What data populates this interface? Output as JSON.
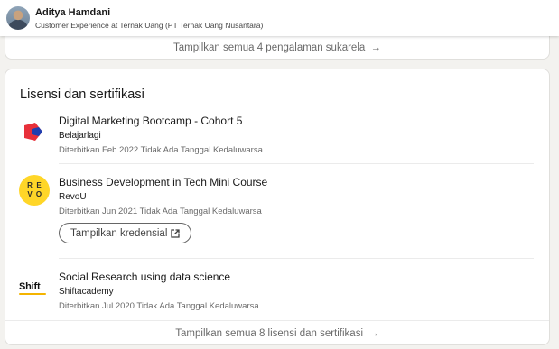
{
  "header": {
    "name": "Aditya Hamdani",
    "headline": "Customer Experience at Ternak Uang (PT Ternak Uang Nusantara)"
  },
  "volunteer": {
    "show_all_label": "Tampilkan semua 4 pengalaman sukarela",
    "arrow": "→"
  },
  "certifications": {
    "title": "Lisensi dan sertifikasi",
    "items": [
      {
        "title": "Digital Marketing Bootcamp - Cohort 5",
        "org": "Belajarlagi",
        "date": "Diterbitkan Feb 2022 Tidak Ada Tanggal Kedaluwarsa",
        "logo": "belajarlagi-logo"
      },
      {
        "title": "Business Development in Tech Mini Course",
        "org": "RevoU",
        "date": "Diterbitkan Jun 2021 Tidak Ada Tanggal Kedaluwarsa",
        "logo": "revou-logo",
        "logo_letters": [
          "R",
          "E",
          "V",
          "O"
        ],
        "button": "Tampilkan kredensial"
      },
      {
        "title": "Social Research using data science",
        "org": "Shiftacademy",
        "date": "Diterbitkan Jul 2020 Tidak Ada Tanggal Kedaluwarsa",
        "logo": "shiftacademy-logo",
        "logo_text": "Shift"
      }
    ],
    "show_all_label": "Tampilkan semua 8 lisensi dan sertifikasi",
    "arrow": "→"
  },
  "colors": {
    "background": "#f3f2ef",
    "card": "#ffffff",
    "revou_yellow": "#ffd628",
    "belajarlagi_red": "#e8303a",
    "belajarlagi_blue": "#1f3fb0",
    "shift_accent": "#f4b400"
  },
  "icons": {
    "external_link": "external-link-icon",
    "arrow_right": "arrow-right-icon"
  }
}
